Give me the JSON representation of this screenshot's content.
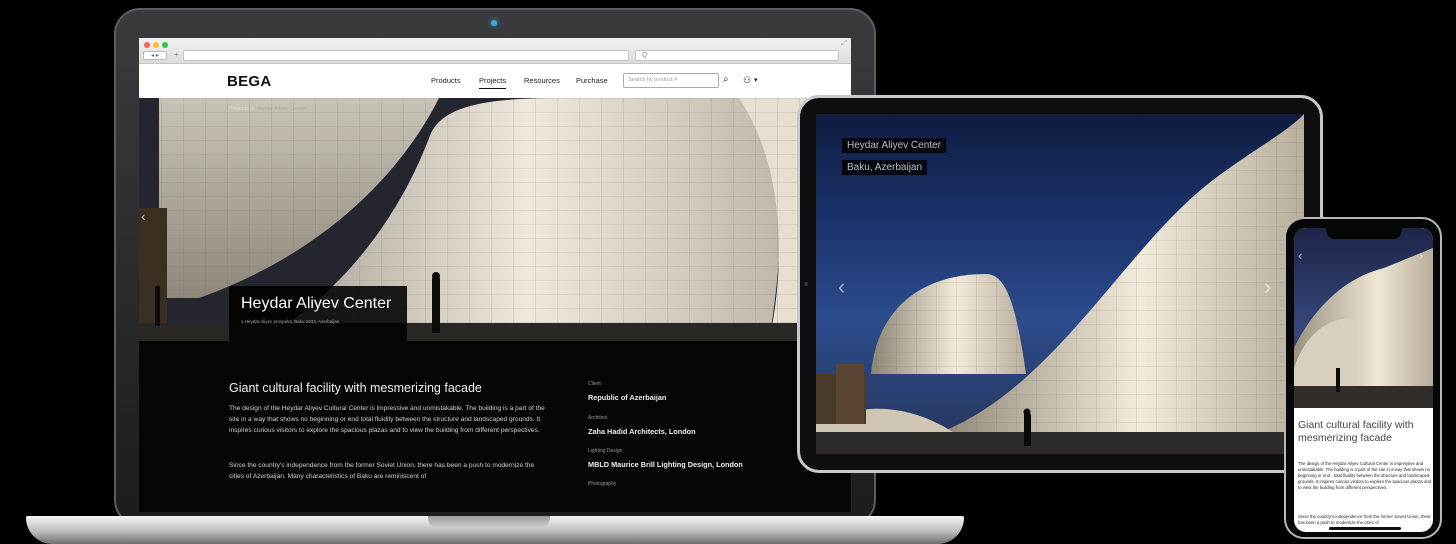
{
  "browser": {
    "search_placeholder": "Q"
  },
  "site": {
    "logo": "BEGA",
    "nav": [
      "Products",
      "Projects",
      "Resources",
      "Purchase"
    ],
    "active_nav": "Projects",
    "search_placeholder": "Search by product #"
  },
  "breadcrumb": {
    "parent": "Projects",
    "separator": ">",
    "current": "Heydar Aliyev Center"
  },
  "hero": {
    "title": "Heydar Aliyev Center",
    "address": "1 Heydar Aliyev prospekti, Baku 1033, Azerbaijan"
  },
  "content": {
    "heading": "Giant cultural facility with mesmerizing facade",
    "paragraph1": "The design of the Heydar Aliyev Cultural Center is impressive and unmistakable. The building is a part of the site in a way that shows no beginning or end total fluidity between the structure and landscaped grounds. It inspires curious visitors to explore the spacious plazas and to view the building from different perspectives.",
    "paragraph2": "Since the country's independence from the former Soviet Union, there has been a push to modernize the cities of Azerbaijan. Many characteristics of Baku are reminiscent of"
  },
  "meta": [
    {
      "label": "Client",
      "value": "Republic of Azerbaijan"
    },
    {
      "label": "Architect",
      "value": "Zaha Hadid Architects, London"
    },
    {
      "label": "Lighting Design",
      "value": "MBLD Maurice Brill Lighting Design, London"
    },
    {
      "label": "Photography",
      "value": ""
    }
  ],
  "tablet": {
    "title": "Heydar Aliyev Center",
    "location": "Baku, Azerbaijan"
  },
  "phone": {
    "heading": "Giant cultural facility with mesmerizing facade",
    "paragraph1": "The design of the Heydar Aliyev Cultural Center is impressive and unmistakable. The building is a part of the site in a way that shows no beginning or end - total fluidity between the structure and landscaped grounds. It inspires curious visitors to explore the spacious plazas and to view the building from different perspectives.",
    "paragraph2": "Since the country's independence from the former Soviet Union, there has been a push to modernize the cities of"
  },
  "colors": {
    "background": "#000000",
    "accent_dot": "#37a9d6"
  },
  "icons": [
    "search-icon",
    "user-icon",
    "chevron-left-icon",
    "chevron-right-icon"
  ]
}
